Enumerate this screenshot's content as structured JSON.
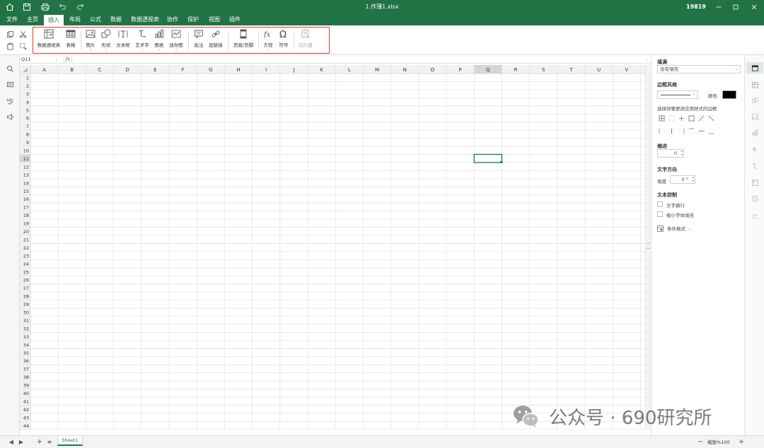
{
  "window": {
    "title": "1.作薄1.xlsx",
    "counter": "19819"
  },
  "menu": {
    "items": [
      "文件",
      "主页",
      "插入",
      "布局",
      "公式",
      "数据",
      "数据透视表",
      "协作",
      "保护",
      "视图",
      "插件"
    ],
    "active": "插入"
  },
  "ribbon": {
    "buttons": [
      {
        "label": "数据透视表",
        "icon": "pivot-table-icon",
        "dropdown": false,
        "disabled": false
      },
      {
        "label": "表格",
        "icon": "table-icon",
        "dropdown": false,
        "disabled": false
      },
      {
        "label": "图片",
        "icon": "image-icon",
        "dropdown": true,
        "disabled": false
      },
      {
        "label": "形状",
        "icon": "shape-icon",
        "dropdown": true,
        "disabled": false
      },
      {
        "label": "文本框",
        "icon": "textbox-icon",
        "dropdown": false,
        "disabled": false
      },
      {
        "label": "艺术字",
        "icon": "text-art-icon",
        "dropdown": true,
        "disabled": false
      },
      {
        "label": "图表",
        "icon": "chart-icon",
        "dropdown": true,
        "disabled": false
      },
      {
        "label": "迷你图",
        "icon": "sparkline-icon",
        "dropdown": true,
        "disabled": false
      },
      {
        "label": "批注",
        "icon": "comment-icon",
        "dropdown": false,
        "disabled": false
      },
      {
        "label": "超链接",
        "icon": "hyperlink-icon",
        "dropdown": false,
        "disabled": false
      },
      {
        "label": "页眉/页脚",
        "icon": "header-footer-icon",
        "dropdown": false,
        "disabled": false
      },
      {
        "label": "方程",
        "icon": "equation-icon",
        "dropdown": true,
        "disabled": false
      },
      {
        "label": "符号",
        "icon": "omega-icon",
        "dropdown": false,
        "disabled": false
      },
      {
        "label": "切片器",
        "icon": "slicer-icon",
        "dropdown": false,
        "disabled": true
      }
    ]
  },
  "formula_bar": {
    "name_box": "Q11",
    "fx": "fx",
    "value": ""
  },
  "grid": {
    "columns": [
      "A",
      "B",
      "C",
      "D",
      "E",
      "F",
      "G",
      "H",
      "I",
      "J",
      "K",
      "L",
      "M",
      "N",
      "O",
      "P",
      "Q",
      "R",
      "S",
      "T",
      "U",
      "V"
    ],
    "rows": 44,
    "selected_cell": "Q11",
    "selected_column": "Q",
    "selected_row": 11
  },
  "right_panel": {
    "fill_title": "填满",
    "fill_value": "没有填充",
    "border_title": "边框风格",
    "color_label": "颜色",
    "border_hint": "选择你要更改应用样式的边框",
    "indent_title": "缩进",
    "indent_value": "0",
    "text_direction_title": "文字方向",
    "angle_label": "角度",
    "angle_value": "0 °",
    "text_control_title": "文本控制",
    "wrap_text": "文字换行",
    "shrink_to_fit": "缩小字体填充",
    "conditional_format": "条件格式"
  },
  "bottom": {
    "sheet_tab": "Sheet1",
    "zoom_label": "缩放%100"
  },
  "watermark": {
    "text": "公众号 · 690研究所"
  },
  "colors": {
    "brand_green": "#217346",
    "highlight_red": "#e53935"
  }
}
